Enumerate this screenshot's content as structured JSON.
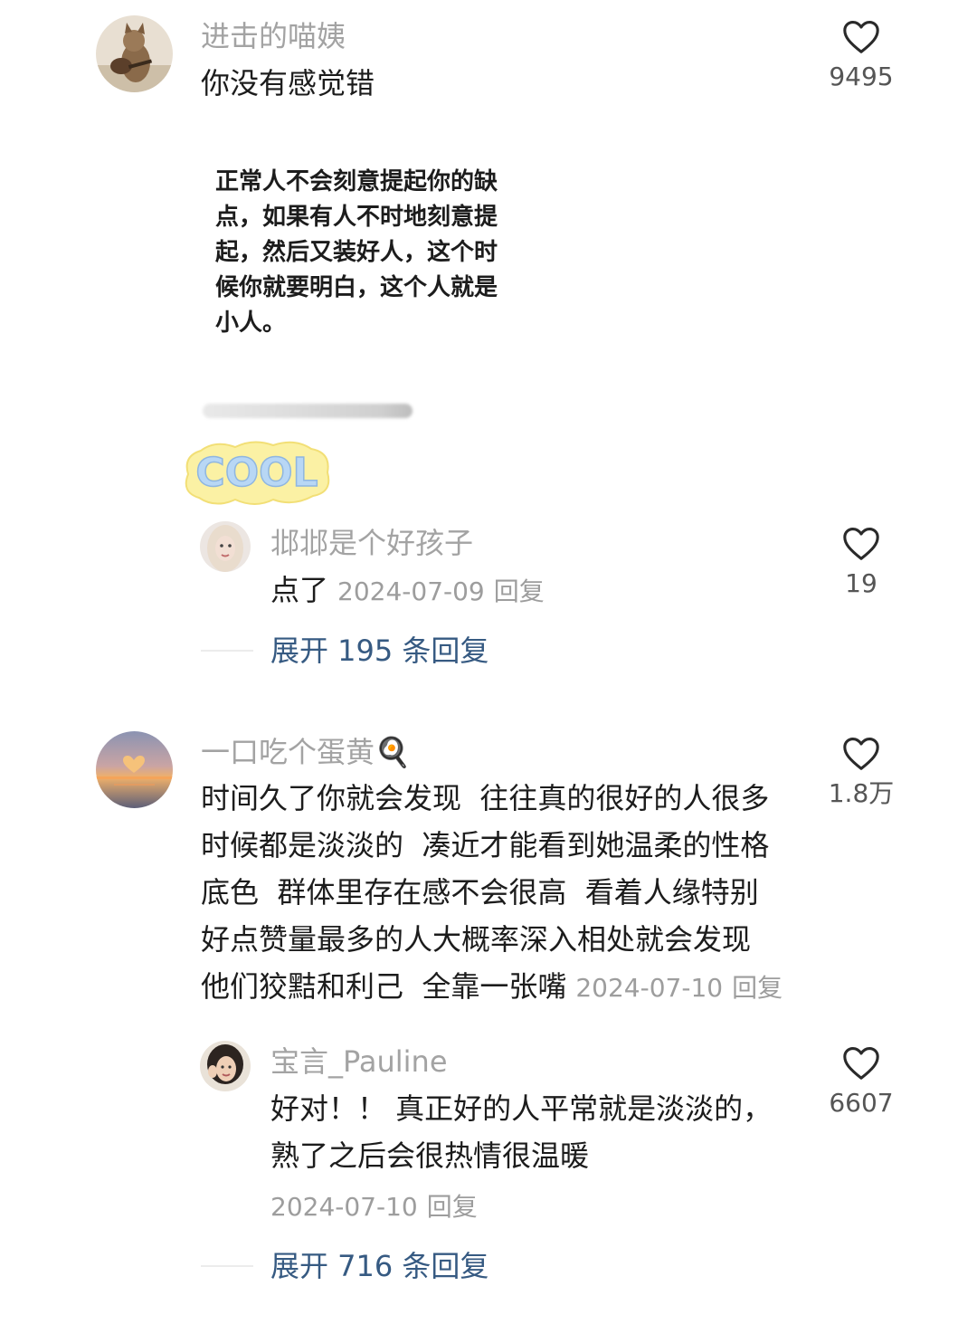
{
  "comments": [
    {
      "username": "进击的喵姨",
      "text": "你没有感觉错",
      "likes": "9495",
      "image_card": {
        "lines": [
          "正常人不会刻意提起你的缺",
          "点，如果有人不时地刻意提",
          "起，然后又装好人，这个时",
          "候你就要明白，这个人就是",
          "小人。"
        ]
      },
      "sticker_text": "COOL",
      "reply": {
        "username": "邶邶是个好孩子",
        "text": "点了",
        "date": "2024-07-09",
        "reply_label": "回复",
        "likes": "19"
      },
      "expand_label": "展开 195 条回复"
    },
    {
      "username": "一口吃个蛋黄",
      "username_emoji": "🍳",
      "text_lines": [
        "时间久了你就会发现  往往真的很好的人很多",
        "时候都是淡淡的  凑近才能看到她温柔的性格",
        "底色  群体里存在感不会很高  看着人缘特别",
        "好点赞量最多的人大概率深入相处就会发现",
        "他们狡黠和利己  全靠一张嘴"
      ],
      "date": "2024-07-10",
      "reply_label": "回复",
      "likes": "1.8万",
      "reply": {
        "username": "宝言_Pauline",
        "text_lines": [
          "好对！！ 真正好的人平常就是淡淡的，",
          "熟了之后会很热情很温暖"
        ],
        "date": "2024-07-10",
        "reply_label": "回复",
        "likes": "6607"
      },
      "expand_label": "展开 716 条回复"
    }
  ],
  "icons": {
    "like": "heart-outline-icon"
  },
  "colors": {
    "username": "#a3a3a3",
    "text": "#1c1c1c",
    "expand": "#365a82"
  }
}
